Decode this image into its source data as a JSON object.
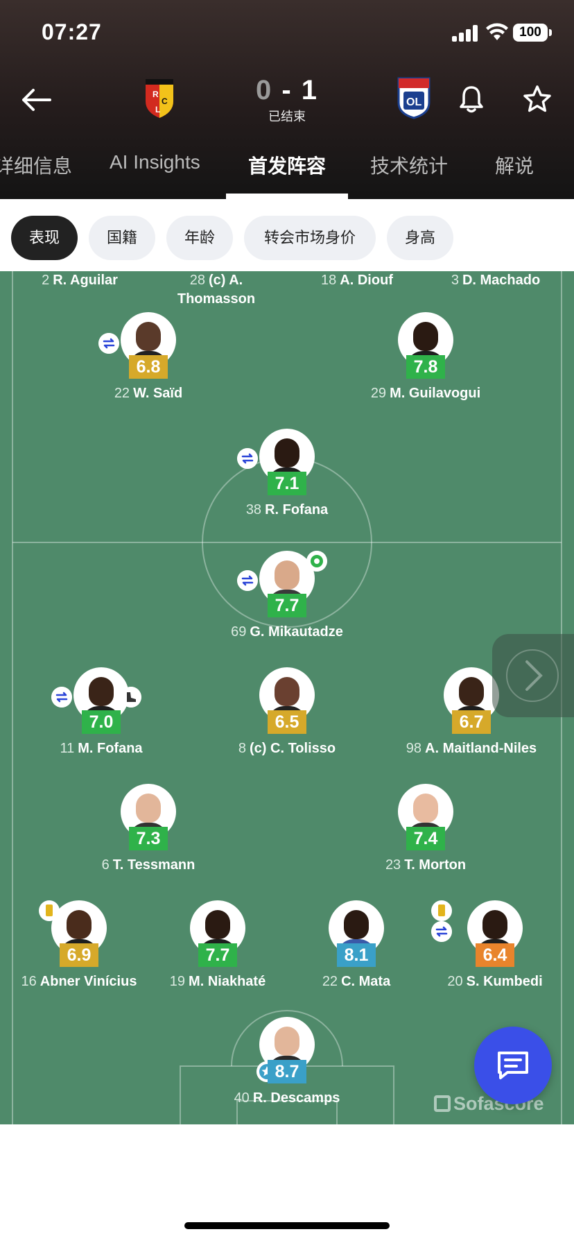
{
  "status_bar": {
    "time": "07:27",
    "battery": "100"
  },
  "match": {
    "home_score": "0",
    "separator": "-",
    "away_score": "1",
    "status": "已结束",
    "home_badge_icon": "lens-badge-icon",
    "away_badge_icon": "lyon-badge-icon"
  },
  "tabs": [
    {
      "label": "详细信息"
    },
    {
      "label": "AI Insights"
    },
    {
      "label": "首发阵容"
    },
    {
      "label": "技术统计"
    },
    {
      "label": "解说"
    }
  ],
  "filters": [
    {
      "label": "表现"
    },
    {
      "label": "国籍"
    },
    {
      "label": "年龄"
    },
    {
      "label": "转会市场身价"
    },
    {
      "label": "身高"
    }
  ],
  "colors": {
    "rating_green": "#2fb24a",
    "rating_yellow": "#d6a92a",
    "rating_orange": "#e8842c",
    "rating_blue": "#3aa0c8",
    "pitch": "#4f8a6a",
    "accent_blue": "#3a4fe8"
  },
  "top_row": [
    {
      "number": "2",
      "name": "R. Aguilar"
    },
    {
      "number": "28",
      "name": "(c) A.",
      "name2": "Thomasson"
    },
    {
      "number": "18",
      "name": "A. Diouf"
    },
    {
      "number": "3",
      "name": "D. Machado"
    }
  ],
  "players": {
    "said": {
      "number": "22",
      "name": "W. Saïd",
      "rating": "6.8"
    },
    "guilavogui": {
      "number": "29",
      "name": "M. Guilavogui",
      "rating": "7.8"
    },
    "r_fofana": {
      "number": "38",
      "name": "R. Fofana",
      "rating": "7.1"
    },
    "mikautadze": {
      "number": "69",
      "name": "G. Mikautadze",
      "rating": "7.7"
    },
    "m_fofana": {
      "number": "11",
      "name": "M. Fofana",
      "rating": "7.0"
    },
    "tolisso": {
      "number": "8",
      "name": "(c) C. Tolisso",
      "rating": "6.5"
    },
    "maitland": {
      "number": "98",
      "name": "A. Maitland-Niles",
      "rating": "6.7"
    },
    "tessmann": {
      "number": "6",
      "name": "T. Tessmann",
      "rating": "7.3"
    },
    "morton": {
      "number": "23",
      "name": "T. Morton",
      "rating": "7.4"
    },
    "abner": {
      "number": "16",
      "name": "Abner Vinícius",
      "rating": "6.9"
    },
    "niakhate": {
      "number": "19",
      "name": "M. Niakhaté",
      "rating": "7.7"
    },
    "mata": {
      "number": "22",
      "name": "C. Mata",
      "rating": "8.1"
    },
    "kumbedi": {
      "number": "20",
      "name": "S. Kumbedi",
      "rating": "6.4"
    },
    "descamps": {
      "number": "40",
      "name": "R. Descamps",
      "rating": "8.7"
    }
  },
  "watermark": "Sofascore"
}
